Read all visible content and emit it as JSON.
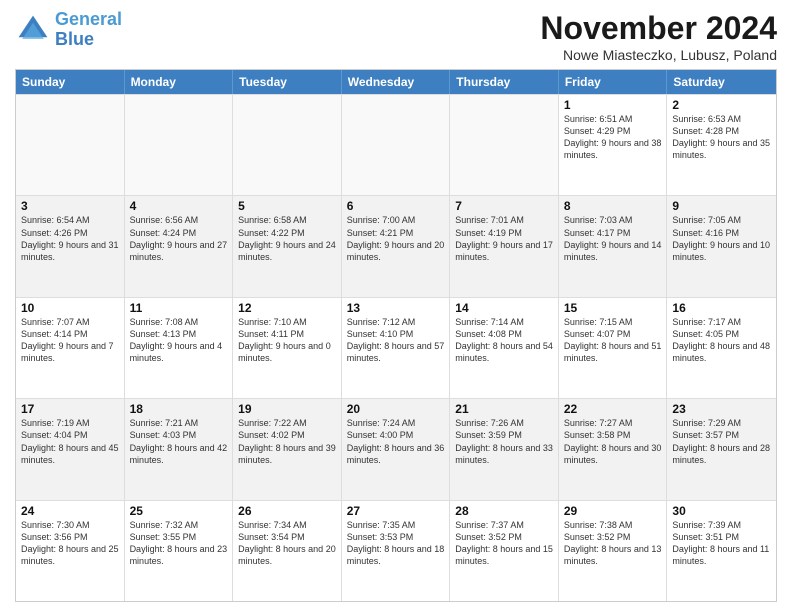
{
  "logo": {
    "line1": "General",
    "line2": "Blue"
  },
  "title": "November 2024",
  "subtitle": "Nowe Miasteczko, Lubusz, Poland",
  "headers": [
    "Sunday",
    "Monday",
    "Tuesday",
    "Wednesday",
    "Thursday",
    "Friday",
    "Saturday"
  ],
  "rows": [
    [
      {
        "day": "",
        "info": ""
      },
      {
        "day": "",
        "info": ""
      },
      {
        "day": "",
        "info": ""
      },
      {
        "day": "",
        "info": ""
      },
      {
        "day": "",
        "info": ""
      },
      {
        "day": "1",
        "info": "Sunrise: 6:51 AM\nSunset: 4:29 PM\nDaylight: 9 hours and 38 minutes."
      },
      {
        "day": "2",
        "info": "Sunrise: 6:53 AM\nSunset: 4:28 PM\nDaylight: 9 hours and 35 minutes."
      }
    ],
    [
      {
        "day": "3",
        "info": "Sunrise: 6:54 AM\nSunset: 4:26 PM\nDaylight: 9 hours and 31 minutes."
      },
      {
        "day": "4",
        "info": "Sunrise: 6:56 AM\nSunset: 4:24 PM\nDaylight: 9 hours and 27 minutes."
      },
      {
        "day": "5",
        "info": "Sunrise: 6:58 AM\nSunset: 4:22 PM\nDaylight: 9 hours and 24 minutes."
      },
      {
        "day": "6",
        "info": "Sunrise: 7:00 AM\nSunset: 4:21 PM\nDaylight: 9 hours and 20 minutes."
      },
      {
        "day": "7",
        "info": "Sunrise: 7:01 AM\nSunset: 4:19 PM\nDaylight: 9 hours and 17 minutes."
      },
      {
        "day": "8",
        "info": "Sunrise: 7:03 AM\nSunset: 4:17 PM\nDaylight: 9 hours and 14 minutes."
      },
      {
        "day": "9",
        "info": "Sunrise: 7:05 AM\nSunset: 4:16 PM\nDaylight: 9 hours and 10 minutes."
      }
    ],
    [
      {
        "day": "10",
        "info": "Sunrise: 7:07 AM\nSunset: 4:14 PM\nDaylight: 9 hours and 7 minutes."
      },
      {
        "day": "11",
        "info": "Sunrise: 7:08 AM\nSunset: 4:13 PM\nDaylight: 9 hours and 4 minutes."
      },
      {
        "day": "12",
        "info": "Sunrise: 7:10 AM\nSunset: 4:11 PM\nDaylight: 9 hours and 0 minutes."
      },
      {
        "day": "13",
        "info": "Sunrise: 7:12 AM\nSunset: 4:10 PM\nDaylight: 8 hours and 57 minutes."
      },
      {
        "day": "14",
        "info": "Sunrise: 7:14 AM\nSunset: 4:08 PM\nDaylight: 8 hours and 54 minutes."
      },
      {
        "day": "15",
        "info": "Sunrise: 7:15 AM\nSunset: 4:07 PM\nDaylight: 8 hours and 51 minutes."
      },
      {
        "day": "16",
        "info": "Sunrise: 7:17 AM\nSunset: 4:05 PM\nDaylight: 8 hours and 48 minutes."
      }
    ],
    [
      {
        "day": "17",
        "info": "Sunrise: 7:19 AM\nSunset: 4:04 PM\nDaylight: 8 hours and 45 minutes."
      },
      {
        "day": "18",
        "info": "Sunrise: 7:21 AM\nSunset: 4:03 PM\nDaylight: 8 hours and 42 minutes."
      },
      {
        "day": "19",
        "info": "Sunrise: 7:22 AM\nSunset: 4:02 PM\nDaylight: 8 hours and 39 minutes."
      },
      {
        "day": "20",
        "info": "Sunrise: 7:24 AM\nSunset: 4:00 PM\nDaylight: 8 hours and 36 minutes."
      },
      {
        "day": "21",
        "info": "Sunrise: 7:26 AM\nSunset: 3:59 PM\nDaylight: 8 hours and 33 minutes."
      },
      {
        "day": "22",
        "info": "Sunrise: 7:27 AM\nSunset: 3:58 PM\nDaylight: 8 hours and 30 minutes."
      },
      {
        "day": "23",
        "info": "Sunrise: 7:29 AM\nSunset: 3:57 PM\nDaylight: 8 hours and 28 minutes."
      }
    ],
    [
      {
        "day": "24",
        "info": "Sunrise: 7:30 AM\nSunset: 3:56 PM\nDaylight: 8 hours and 25 minutes."
      },
      {
        "day": "25",
        "info": "Sunrise: 7:32 AM\nSunset: 3:55 PM\nDaylight: 8 hours and 23 minutes."
      },
      {
        "day": "26",
        "info": "Sunrise: 7:34 AM\nSunset: 3:54 PM\nDaylight: 8 hours and 20 minutes."
      },
      {
        "day": "27",
        "info": "Sunrise: 7:35 AM\nSunset: 3:53 PM\nDaylight: 8 hours and 18 minutes."
      },
      {
        "day": "28",
        "info": "Sunrise: 7:37 AM\nSunset: 3:52 PM\nDaylight: 8 hours and 15 minutes."
      },
      {
        "day": "29",
        "info": "Sunrise: 7:38 AM\nSunset: 3:52 PM\nDaylight: 8 hours and 13 minutes."
      },
      {
        "day": "30",
        "info": "Sunrise: 7:39 AM\nSunset: 3:51 PM\nDaylight: 8 hours and 11 minutes."
      }
    ]
  ]
}
